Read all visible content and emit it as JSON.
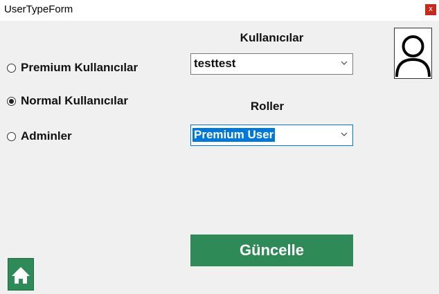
{
  "window": {
    "title": "UserTypeForm",
    "close_label": "x"
  },
  "user_type_options": [
    {
      "label": "Premium Kullanıcılar",
      "checked": false
    },
    {
      "label": "Normal Kullanıcılar",
      "checked": true
    },
    {
      "label": "Adminler",
      "checked": false
    }
  ],
  "users_section": {
    "heading": "Kullanıcılar",
    "selected_value": "testtest"
  },
  "roles_section": {
    "heading": "Roller",
    "selected_value": "Premium User"
  },
  "update_button": {
    "label": "Güncelle"
  },
  "colors": {
    "accent_green": "#2e8b57",
    "selection_blue": "#0078d7",
    "close_red": "#c42b1c"
  },
  "icons": {
    "avatar": "user-avatar-icon",
    "home": "home-icon",
    "dropdown": "chevron-down-icon"
  }
}
